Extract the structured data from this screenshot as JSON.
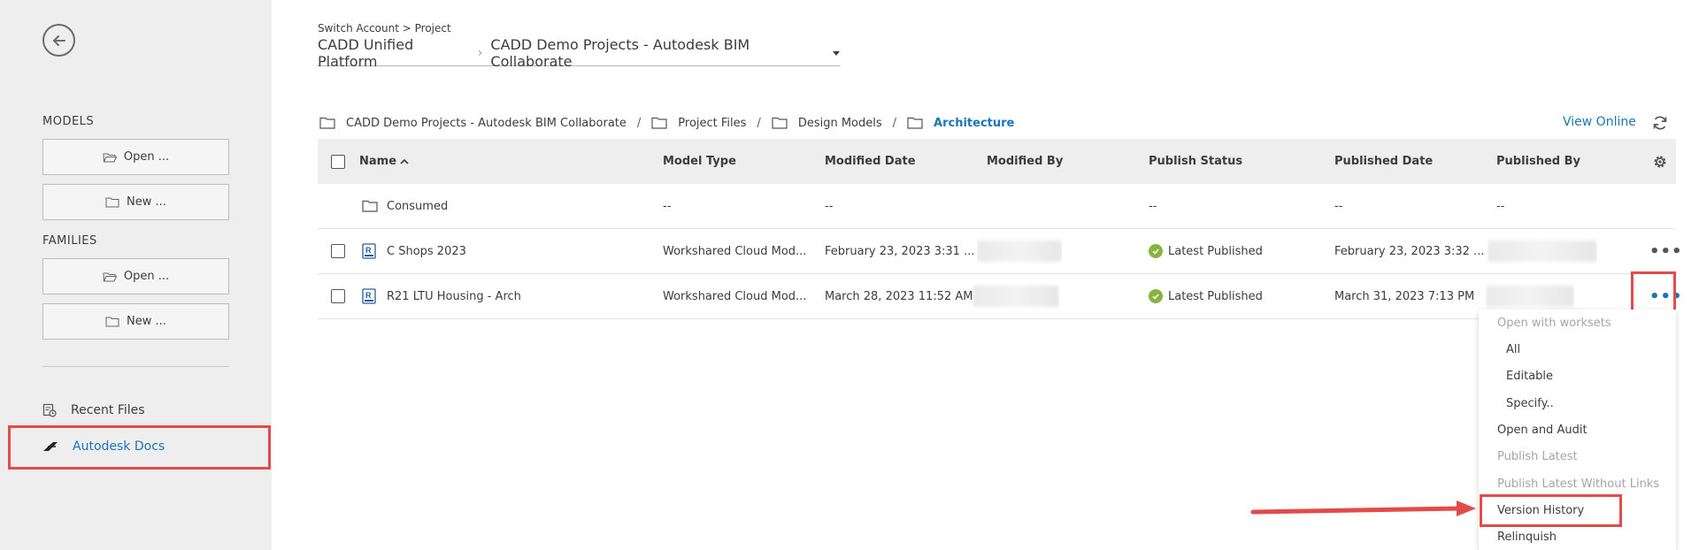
{
  "colors": {
    "accent": "#1b76b9",
    "highlight": "#e34b4b",
    "success": "#87b340",
    "sidebar_bg": "#eeeeee"
  },
  "sidebar": {
    "back_icon": "back-arrow-icon",
    "models_label": "MODELS",
    "models_open": "Open ...",
    "models_new": "New ...",
    "families_label": "FAMILIES",
    "families_open": "Open ...",
    "families_new": "New ...",
    "recent_files": "Recent Files",
    "autodesk_docs": "Autodesk Docs"
  },
  "header": {
    "breadcrumb": "Switch Account > Project",
    "account": "CADD Unified Platform",
    "project": "CADD Demo Projects - Autodesk BIM Collaborate"
  },
  "path": {
    "segments": [
      "CADD Demo Projects - Autodesk BIM Collaborate",
      "Project Files",
      "Design Models"
    ],
    "current": "Architecture",
    "view_online": "View Online"
  },
  "table": {
    "columns": {
      "name": "Name",
      "model_type": "Model Type",
      "modified_date": "Modified Date",
      "modified_by": "Modified By",
      "publish_status": "Publish Status",
      "published_date": "Published Date",
      "published_by": "Published By"
    },
    "rows": [
      {
        "name": "Consumed",
        "model_type": "--",
        "modified_date": "--",
        "publish_status": "--",
        "published_date": "--",
        "published_by": "--"
      },
      {
        "name": "C Shops 2023",
        "model_type": "Workshared Cloud Mod...",
        "modified_date": "February 23, 2023 3:31 ...",
        "publish_status": "Latest Published",
        "published_date": "February 23, 2023 3:32 ..."
      },
      {
        "name": "R21 LTU Housing - Arch",
        "model_type": "Workshared Cloud Mod...",
        "modified_date": "March 28, 2023 11:52 AM",
        "publish_status": "Latest Published",
        "published_date": "March 31, 2023 7:13 PM"
      }
    ]
  },
  "context_menu": {
    "open_with_worksets": "Open with worksets",
    "all": "All",
    "editable": "Editable",
    "specify": "Specify..",
    "open_and_audit": "Open and Audit",
    "publish_latest": "Publish Latest",
    "publish_latest_without_links": "Publish Latest Without Links",
    "version_history": "Version History",
    "relinquish": "Relinquish"
  }
}
